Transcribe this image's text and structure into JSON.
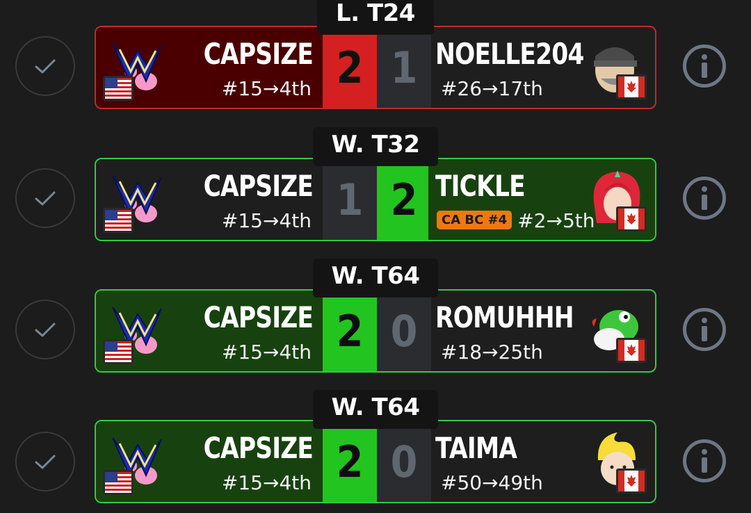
{
  "matches": [
    {
      "round": "L. T24",
      "result": "loss",
      "player1": {
        "name": "CAPSIZE",
        "seed": "#15→4th",
        "score": "2",
        "flag": "us-flag-icon"
      },
      "player2": {
        "name": "NOELLE204",
        "seed": "#26→17th",
        "score": "1",
        "flag": "canada-flag-icon",
        "character": "snake-character-icon"
      }
    },
    {
      "round": "W. T32",
      "result": "loss",
      "player1": {
        "name": "CAPSIZE",
        "seed": "#15→4th",
        "score": "1",
        "flag": "us-flag-icon"
      },
      "player2": {
        "name": "TICKLE",
        "seed": "#2→5th",
        "badge": "CA BC #4",
        "score": "2",
        "flag": "canada-flag-icon",
        "character": "pyra-character-icon"
      }
    },
    {
      "round": "W. T64",
      "result": "win",
      "player1": {
        "name": "CAPSIZE",
        "seed": "#15→4th",
        "score": "2",
        "flag": "us-flag-icon"
      },
      "player2": {
        "name": "ROMUHHH",
        "seed": "#18→25th",
        "score": "0",
        "flag": "canada-flag-icon",
        "character": "yoshi-character-icon"
      }
    },
    {
      "round": "W. T64",
      "result": "win",
      "player1": {
        "name": "CAPSIZE",
        "seed": "#15→4th",
        "score": "2",
        "flag": "us-flag-icon"
      },
      "player2": {
        "name": "TAIMA",
        "seed": "#50→49th",
        "score": "0",
        "flag": "canada-flag-icon",
        "character": "lucas-character-icon"
      }
    }
  ],
  "colors": {
    "win": "#22c41f",
    "loss": "#d42020",
    "badge": "#f07810",
    "background": "#1c1c1c"
  }
}
